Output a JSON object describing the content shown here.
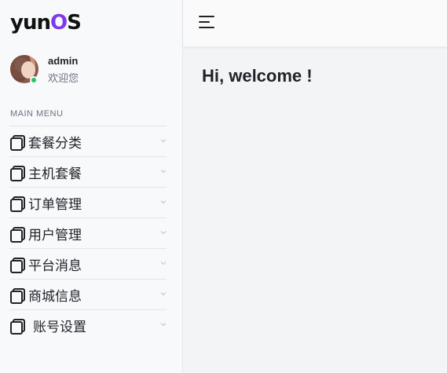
{
  "logo": {
    "part1": "yun",
    "part2": "O",
    "part3": "S"
  },
  "user": {
    "name": "admin",
    "greeting": "欢迎您"
  },
  "menu_title": "MAIN MENU",
  "menu": [
    {
      "label": "套餐分类",
      "icon": "copy-icon"
    },
    {
      "label": "主机套餐",
      "icon": "copy-icon"
    },
    {
      "label": "订单管理",
      "icon": "copy-icon"
    },
    {
      "label": "用户管理",
      "icon": "copy-icon"
    },
    {
      "label": "平台消息",
      "icon": "copy-icon"
    },
    {
      "label": "商城信息",
      "icon": "copy-icon"
    },
    {
      "label": "账号设置",
      "icon": "copy-icon"
    }
  ],
  "main": {
    "welcome": "Hi, welcome !"
  },
  "colors": {
    "accent": "#7c3aed",
    "online": "#22c55e"
  }
}
